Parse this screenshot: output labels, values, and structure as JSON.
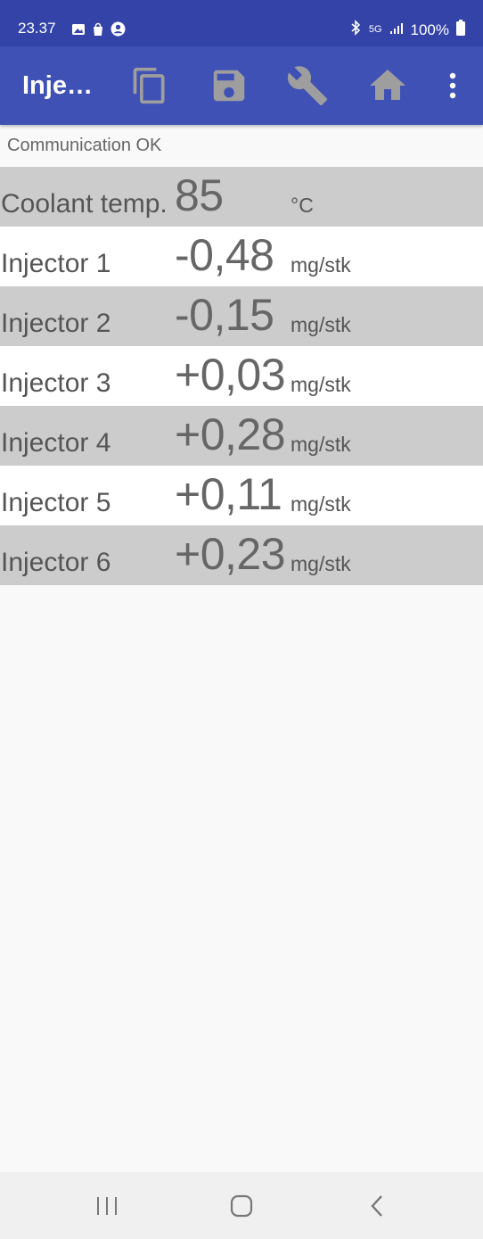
{
  "status_bar": {
    "time": "23.37",
    "signal_label": "5G",
    "battery": "100%"
  },
  "app_bar": {
    "title": "Inje…",
    "icons": [
      "copy-icon",
      "save-icon",
      "wrench-icon",
      "home-icon",
      "more-vert-icon"
    ]
  },
  "status_text": "Communication OK",
  "readings": [
    {
      "label": "Coolant temp.",
      "value": "85",
      "unit": "°C"
    },
    {
      "label": "Injector 1",
      "value": "-0,48",
      "unit": "mg/stk"
    },
    {
      "label": "Injector 2",
      "value": "-0,15",
      "unit": "mg/stk"
    },
    {
      "label": "Injector 3",
      "value": "+0,03",
      "unit": "mg/stk"
    },
    {
      "label": "Injector 4",
      "value": "+0,28",
      "unit": "mg/stk"
    },
    {
      "label": "Injector 5",
      "value": "+0,11",
      "unit": "mg/stk"
    },
    {
      "label": "Injector 6",
      "value": "+0,23",
      "unit": "mg/stk"
    }
  ],
  "nav_bar": {
    "buttons": [
      "recents-icon",
      "home-nav-icon",
      "back-icon"
    ]
  },
  "colors": {
    "status_bar": "#3343a8",
    "app_bar": "#3f51b5",
    "row_gray": "#cccccc",
    "row_white": "#ffffff",
    "background": "#f9f9f9"
  }
}
